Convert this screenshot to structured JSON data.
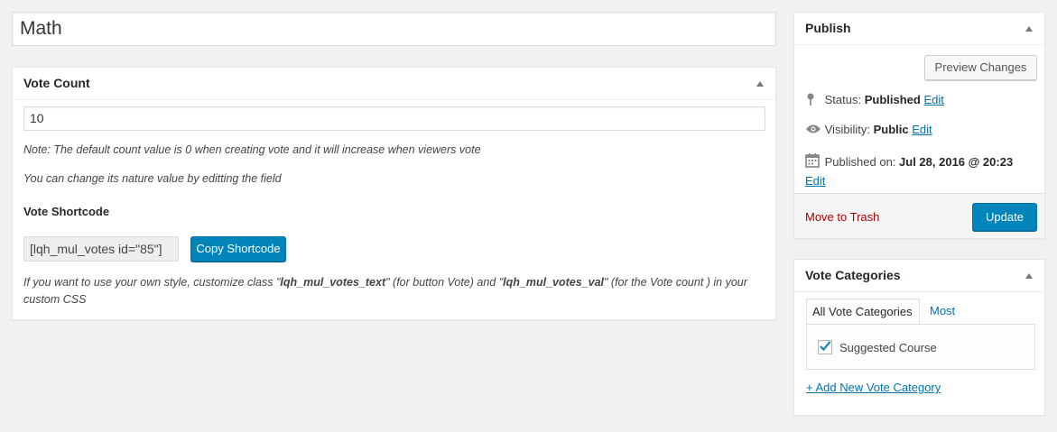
{
  "post": {
    "title": "Math"
  },
  "vote_count_box": {
    "heading": "Vote Count",
    "count_value": "10",
    "note_default": "Note: The default count value is 0 when creating vote and it will increase when viewers vote",
    "note_change": "You can change its nature value by editting the field",
    "shortcode_label": "Vote Shortcode",
    "shortcode_value": "[lqh_mul_votes id=\"85\"]",
    "copy_button_label": "Copy Shortcode",
    "custom_style": {
      "part1": "If you want to use your own style, customize class \"",
      "class1": "lqh_mul_votes_text",
      "part2": "\" (for button Vote) and \"",
      "class2": "lqh_mul_votes_val",
      "part3": "\" (for the Vote count ) in your custom CSS"
    }
  },
  "publish_box": {
    "heading": "Publish",
    "preview_button_label": "Preview Changes",
    "status_label": "Status:",
    "status_value": "Published",
    "visibility_label": "Visibility:",
    "visibility_value": "Public",
    "published_label": "Published on:",
    "published_value": "Jul 28, 2016 @ 20:23",
    "edit_label": "Edit",
    "trash_label": "Move to Trash",
    "update_button_label": "Update"
  },
  "categories_box": {
    "heading": "Vote Categories",
    "tabs": [
      {
        "label": "All Vote Categories",
        "active": true
      },
      {
        "label": "Most Used",
        "active": false
      }
    ],
    "items": [
      {
        "label": "Suggested Course",
        "checked": true
      }
    ],
    "add_new_label": "+ Add New Vote Category"
  },
  "colors": {
    "primary_button": "#0085ba",
    "link": "#0073aa",
    "trash": "#a00000",
    "background": "#f1f1f1"
  },
  "icons": {
    "status": "pin-icon",
    "visibility": "eye-icon",
    "published": "calendar-icon",
    "toggle": "triangle-up-icon",
    "checkbox": "checkmark-icon"
  }
}
